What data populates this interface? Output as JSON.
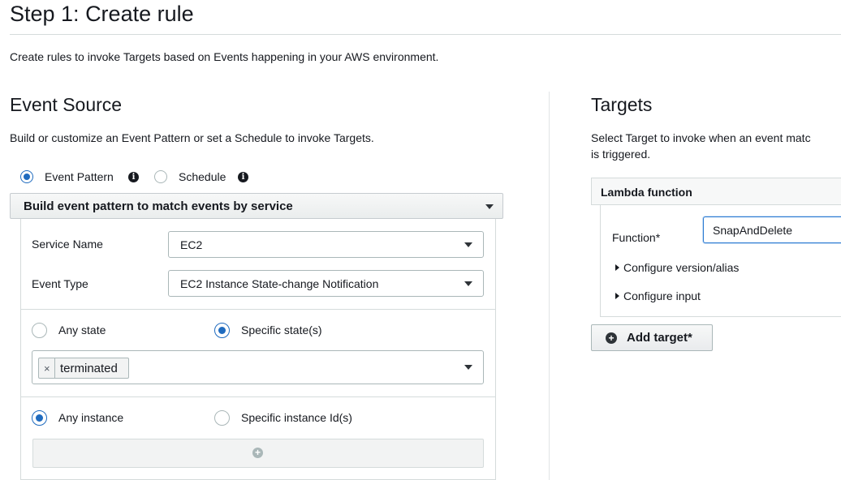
{
  "page": {
    "title": "Step 1: Create rule",
    "description": "Create rules to invoke Targets based on Events happening in your AWS environment."
  },
  "event_source": {
    "heading": "Event Source",
    "description": "Build or customize an Event Pattern or set a Schedule to invoke Targets.",
    "mode_options": [
      {
        "label": "Event Pattern",
        "selected": true
      },
      {
        "label": "Schedule",
        "selected": false
      }
    ],
    "builder_label": "Build event pattern to match events by service",
    "service_name_label": "Service Name",
    "service_name_value": "EC2",
    "event_type_label": "Event Type",
    "event_type_value": "EC2 Instance State-change Notification",
    "state_options": [
      {
        "label": "Any state",
        "selected": false
      },
      {
        "label": "Specific state(s)",
        "selected": true
      }
    ],
    "selected_states": [
      "terminated"
    ],
    "instance_options": [
      {
        "label": "Any instance",
        "selected": true
      },
      {
        "label": "Specific instance Id(s)",
        "selected": false
      }
    ]
  },
  "targets": {
    "heading": "Targets",
    "description_line1": "Select Target to invoke when an event matc",
    "description_line2": "is triggered.",
    "target_type": "Lambda function",
    "function_label": "Function*",
    "function_value": "SnapAndDelete",
    "configure_version_label": "Configure version/alias",
    "configure_input_label": "Configure input",
    "add_target_label": "Add target*"
  },
  "colors": {
    "accent": "#1f6bbf",
    "border": "#d5dbdb",
    "focus": "#2b7bd3"
  }
}
